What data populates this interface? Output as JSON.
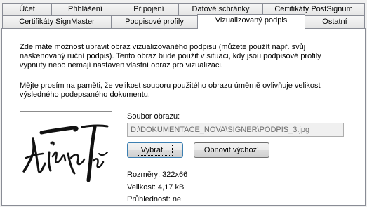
{
  "tabs_row_back": [
    "Účet",
    "Přihlášení",
    "Připojení",
    "Datové schránky",
    "Certifikáty PostSignum"
  ],
  "tabs_row_front": [
    "Certifikáty SignMaster",
    "Podpisové profily",
    "Vizualizovaný podpis",
    "Ostatní"
  ],
  "active_tab": "Vizualizovaný podpis",
  "content": {
    "intro": "Zde máte možnost upravit obraz vizualizovaného podpisu (můžete použít např. svůj naskenovaný ruční podpis). Tento obraz bude použit v situaci, kdy jsou podpisové profily vypnuty nebo nemají nastaven vlastní obraz pro vizualizaci.",
    "note": "Mějte prosím na paměti, že velikost souboru použitého obrazu úměrně ovlivňuje velikost výsledného podepsaného dokumentu.",
    "file_label": "Soubor obrazu:",
    "file_path": "D:\\DOKUMENTACE_NOVA\\SIGNER\\PODPIS_3.jpg",
    "choose_button": "Vybrat...",
    "restore_button": "Obnovit výchozí",
    "dimensions": "Rozměry: 322x66",
    "size": "Velikost: 4,17 kB",
    "transparency": "Průhlednost: ne"
  }
}
